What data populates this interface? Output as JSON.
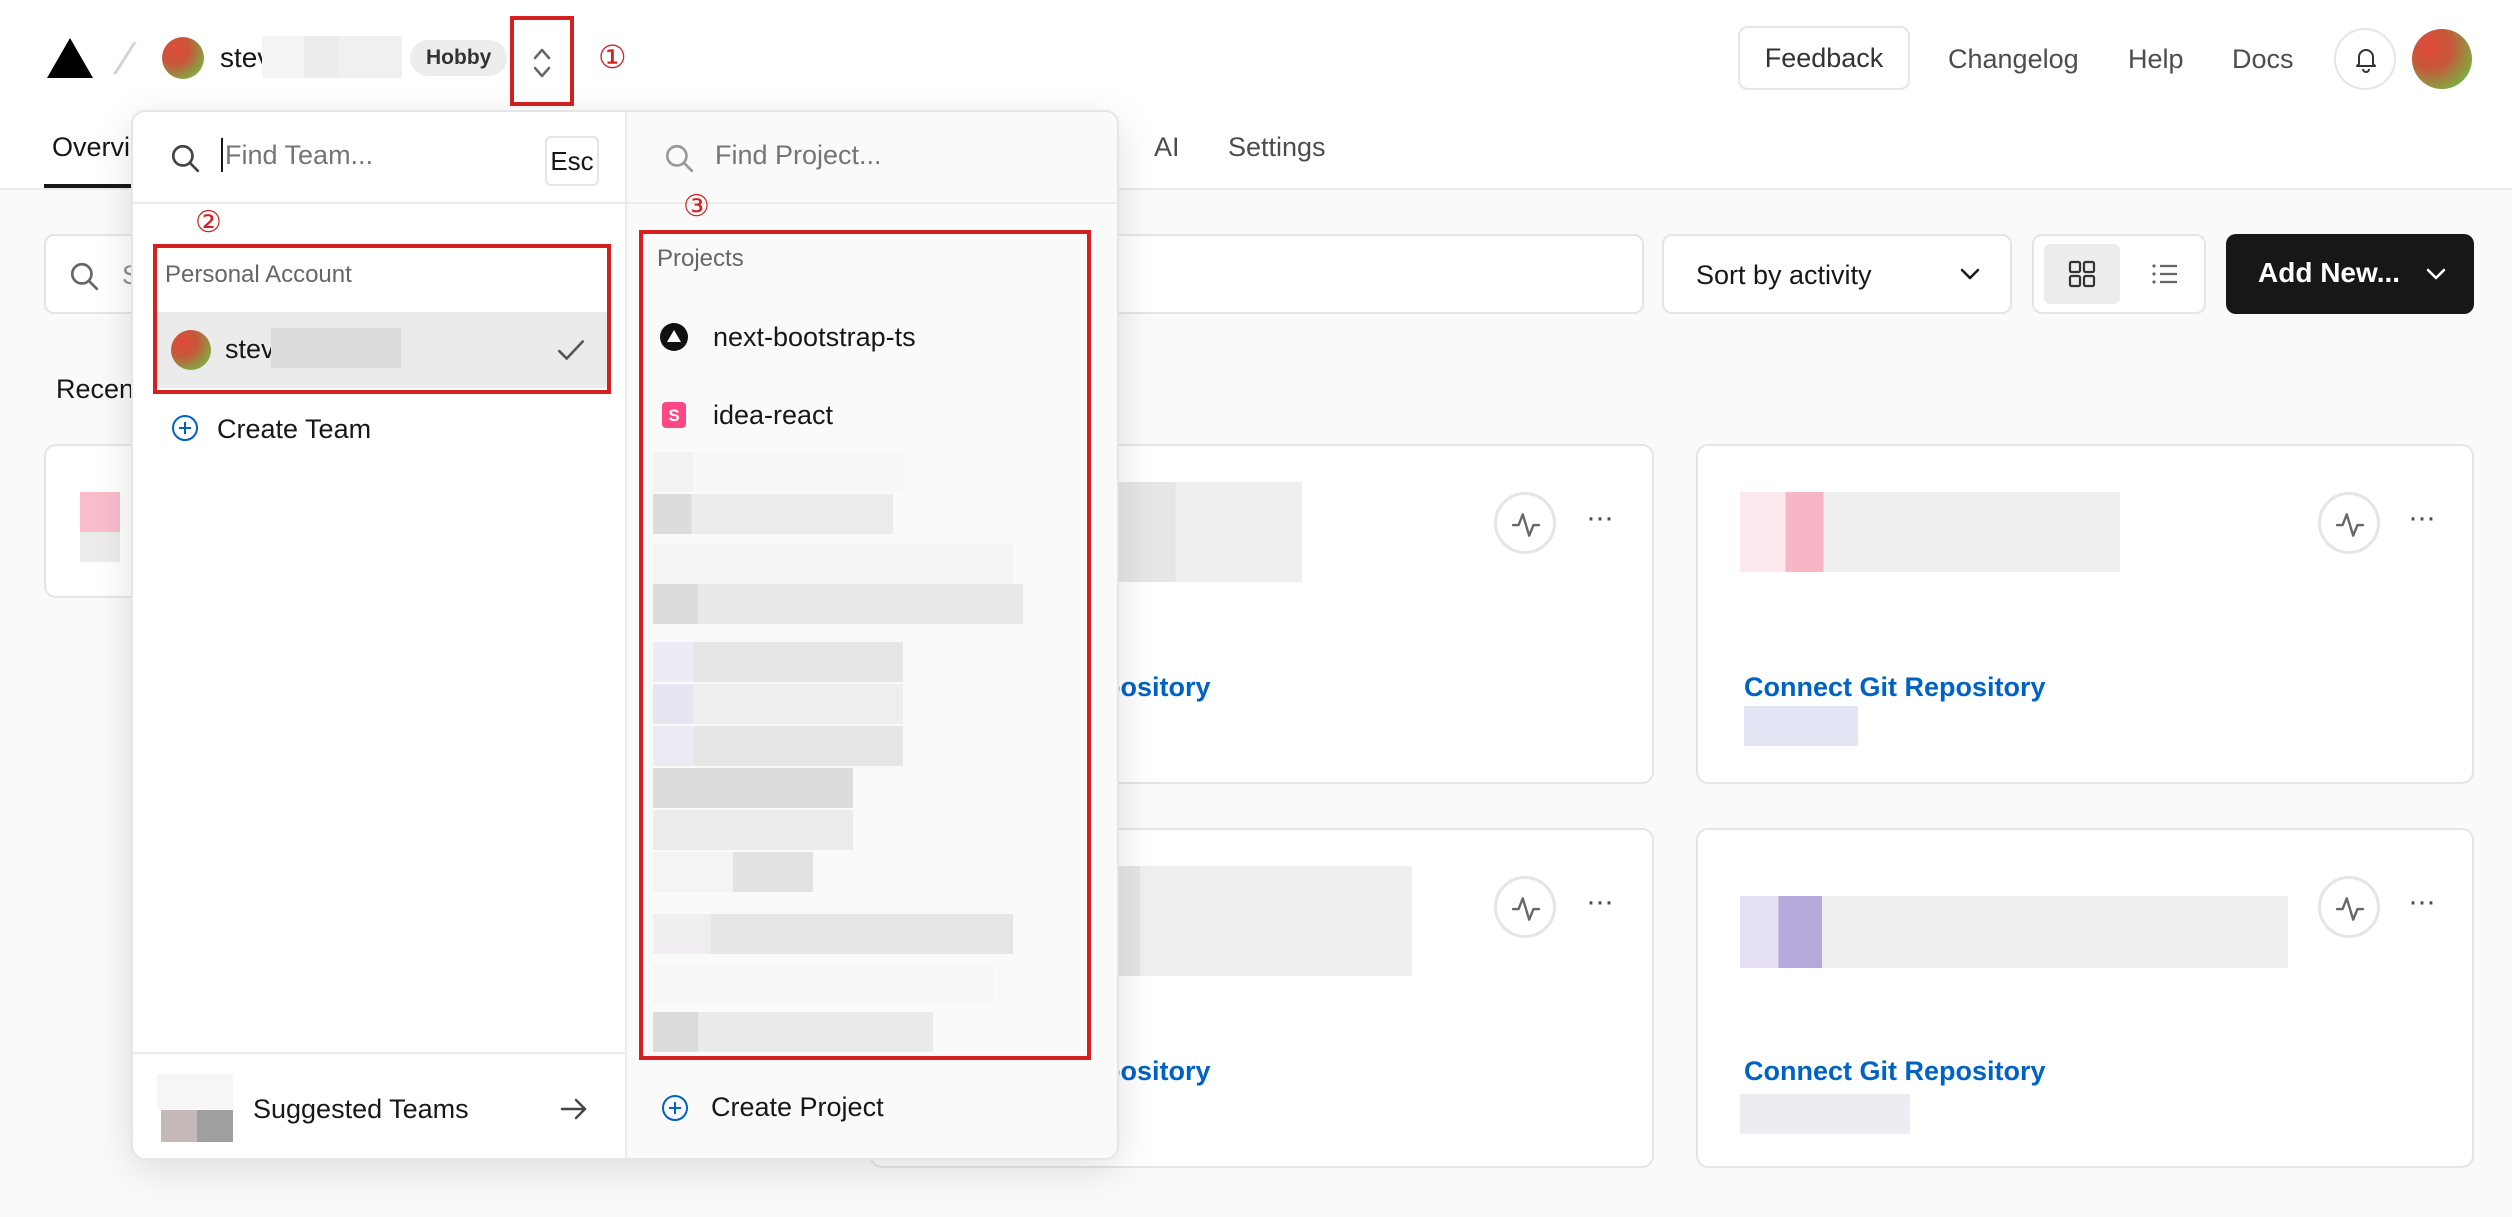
{
  "header": {
    "team_name": "stev",
    "plan_badge": "Hobby",
    "markers": {
      "switcher": "①",
      "teams": "②",
      "projects": "③"
    },
    "feedback": "Feedback",
    "links": [
      "Changelog",
      "Help",
      "Docs"
    ]
  },
  "tabs": {
    "overview": "Overvi",
    "ai": "AI",
    "settings": "Settings"
  },
  "toolbar": {
    "search_placeholder": "S",
    "sort_label": "Sort by activity",
    "add_new_label": "Add New..."
  },
  "recent_label": "Recen",
  "cards": [
    {
      "link": "pository"
    },
    {
      "link": "Connect Git Repository"
    },
    {
      "link": "pository"
    },
    {
      "link": "Connect Git Repository"
    }
  ],
  "team_switcher": {
    "search_placeholder": "Find Team...",
    "esc_key": "Esc",
    "section_label": "Personal Account",
    "selected_team": "stev",
    "create_team": "Create Team",
    "suggested_teams": "Suggested Teams"
  },
  "project_switcher": {
    "search_placeholder": "Find Project...",
    "section_label": "Projects",
    "projects": [
      "next-bootstrap-ts",
      "idea-react"
    ],
    "create_project": "Create Project"
  },
  "colors": {
    "accent_link": "#0062c4",
    "annotation_red": "#d42020",
    "primary_button": "#171717"
  },
  "icons": [
    "vercel-logo-icon",
    "chevron-up-down-icon",
    "bell-icon",
    "search-icon",
    "chevron-down-icon",
    "grid-icon",
    "list-icon",
    "activity-icon",
    "more-icon",
    "check-icon",
    "plus-circle-icon",
    "arrow-right-icon"
  ]
}
